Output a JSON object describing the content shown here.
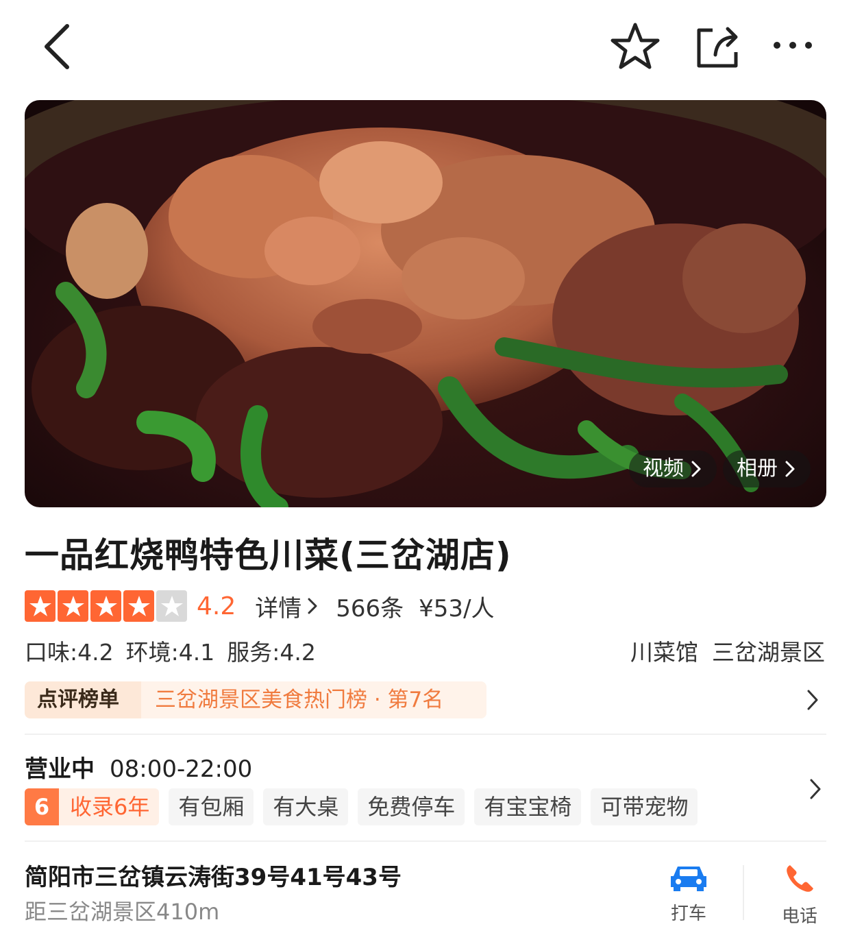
{
  "nav": {
    "back_icon": "chevron-left-icon",
    "favorite_icon": "star-outline-icon",
    "share_icon": "share-icon",
    "more_icon": "more-dots-icon"
  },
  "hero": {
    "video_label": "视频",
    "album_label": "相册"
  },
  "shop": {
    "name": "一品红烧鸭特色川菜(三岔湖店)",
    "stars": 4,
    "score": "4.2",
    "detail_label": "详情",
    "review_count": "566条",
    "avg_price": "¥53/人",
    "sub_scores": {
      "taste": "口味:4.2",
      "environment": "环境:4.1",
      "service": "服务:4.2"
    },
    "category": "川菜馆",
    "area": "三岔湖景区"
  },
  "ranking": {
    "badge": "点评榜单",
    "text": "三岔湖景区美食热门榜 · 第7名"
  },
  "hours": {
    "status": "营业中",
    "time": "08:00-22:00"
  },
  "tags": {
    "years_num": "6",
    "years_text": "收录6年",
    "items": [
      "有包厢",
      "有大桌",
      "免费停车",
      "有宝宝椅",
      "可带宠物"
    ]
  },
  "address": {
    "street": "简阳市三岔镇云涛街39号41号43号",
    "distance": "距三岔湖景区410m"
  },
  "actions": {
    "taxi_label": "打车",
    "call_label": "电话"
  },
  "colors": {
    "accent": "#ff6633",
    "rank_text": "#f07b3f",
    "taxi_blue": "#1a7cf0"
  }
}
